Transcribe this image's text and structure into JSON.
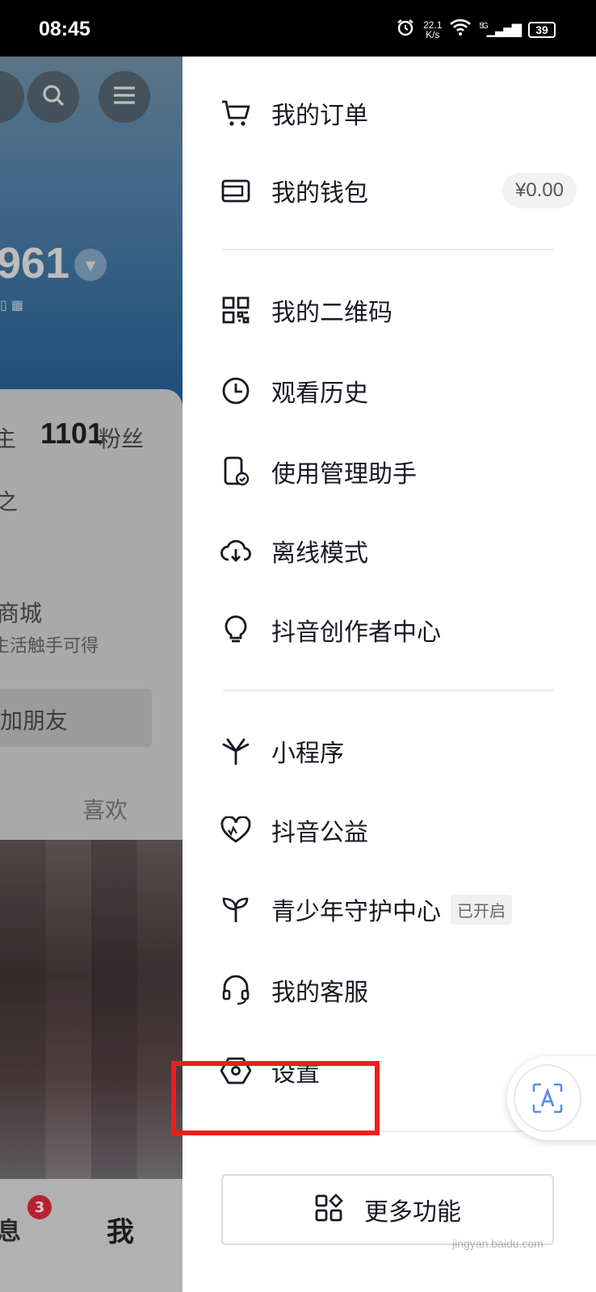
{
  "status_bar": {
    "time": "08:45",
    "net_speed_value": "22.1",
    "net_speed_unit": "K/s",
    "network": "5G",
    "battery": "39"
  },
  "background_profile": {
    "number": "961",
    "followers_count": "1101",
    "followers_label": "粉丝",
    "follow_partial": "主",
    "mall_title": "商城",
    "mall_sub": "生活触手可得",
    "add_friends": "加朋友",
    "likes_tab": "喜欢",
    "messages_tab": "消息",
    "messages_badge": "3",
    "me_tab": "我"
  },
  "drawer": {
    "group1": [
      {
        "label": "我的订单",
        "icon": "cart-icon"
      },
      {
        "label": "我的钱包",
        "icon": "wallet-icon"
      }
    ],
    "wallet_balance": "¥0.00",
    "group2": [
      {
        "label": "我的二维码",
        "icon": "qr-code-icon"
      },
      {
        "label": "观看历史",
        "icon": "clock-icon"
      },
      {
        "label": "使用管理助手",
        "icon": "phone-check-icon"
      },
      {
        "label": "离线模式",
        "icon": "cloud-download-icon"
      },
      {
        "label": "抖音创作者中心",
        "icon": "lightbulb-icon"
      }
    ],
    "group3": [
      {
        "label": "小程序",
        "icon": "asterisk-icon"
      },
      {
        "label": "抖音公益",
        "icon": "heart-icon"
      },
      {
        "label": "青少年守护中心",
        "icon": "sprout-icon"
      },
      {
        "label": "我的客服",
        "icon": "headset-icon"
      },
      {
        "label": "设置",
        "icon": "settings-hexagon-icon"
      }
    ],
    "teen_tag": "已开启",
    "more_button": "更多功能"
  },
  "colors": {
    "highlight": "#f01c1c",
    "badge": "#e02a3c",
    "text": "#161823"
  },
  "watermark": "jingyan.baidu.com"
}
